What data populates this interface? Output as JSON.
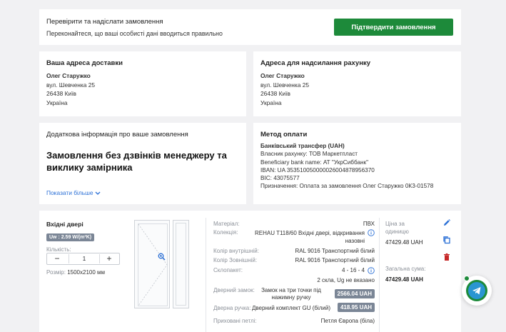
{
  "top": {
    "title": "Перевірити та надіслати замовлення",
    "subtitle": "Переконайтеся, що ваші особисті дані вводиться правильно",
    "confirm_label": "Підтвердити замовлення"
  },
  "shipping": {
    "title": "Ваша адреса доставки",
    "name": "Олег Старужко",
    "street": "вул. Шевченка 25",
    "city": "26438 Київ",
    "country": "Україна"
  },
  "billing": {
    "title": "Адреса для надсилання рахунку",
    "name": "Олег Старужко",
    "street": "вул. Шевченка 25",
    "city": "26438 Київ",
    "country": "Україна"
  },
  "extra": {
    "title": "Додаткова інформація про ваше замовлення",
    "text": "Замовлення без дзвінків менеджеру та виклику замірника",
    "show_more": "Показати більше"
  },
  "payment": {
    "title": "Метод оплати",
    "method": "Банківський трансфер (UAH)",
    "lines": [
      "Власник рахунку: ТОВ Маркетпласт",
      "Beneficiary bank name: АТ \"УкрСиббанк\"",
      "IBAN: UA 353510050000026004878956370",
      "BIC: 43075577",
      "Призначення: Оплата за замовлення Олег Старужко 0К3-01578"
    ]
  },
  "product": {
    "title": "Вхідні двері",
    "uw": "Uw : 2.59 W/(m²K)",
    "qty_label": "Кількість:",
    "qty_minus": "−",
    "qty_plus": "+",
    "qty": "1",
    "size_label": "Розмір:",
    "size": "1500x2100 мм",
    "specs": [
      {
        "k": "Матеріал:",
        "v": "ПВХ"
      },
      {
        "k": "Колекція:",
        "v": "REHAU T118/60 Вхідні двері, відкривання назовні"
      },
      {
        "k": "Колір внутрішній:",
        "v": "RAL 9016 Транспортний білий"
      },
      {
        "k": "Колір Зовнішній:",
        "v": "RAL 9016 Транспортний білий"
      },
      {
        "k": "Склопакет:",
        "v": "4 - 16 - 4"
      },
      {
        "k": "",
        "v": "2 скла, Ug не вказано"
      },
      {
        "k": "Дверний замок:",
        "v": "Замок на три точки під нажимну ручку",
        "price": "2566.04 UAH"
      },
      {
        "k": "Дверна ручка:",
        "v": "Дверний комплект GU (білий)",
        "price": "418.95 UAH"
      },
      {
        "k": "Приховані петлі:",
        "v": "Петля Європа (біла)"
      }
    ],
    "unit_price_label": "Ціна за одиницю",
    "unit_price": "47429.48 UAH",
    "total_label": "Загальна сума:",
    "total": "47429.48 UAH"
  },
  "icons": {
    "edit": "pencil-icon",
    "copy": "copy-icon",
    "delete": "trash-icon",
    "zoom": "zoom-icon",
    "chat": "telegram-icon",
    "info": "info-icon"
  },
  "colors": {
    "accent": "#1d8a3a",
    "link": "#2a6fd6",
    "badge": "#7b8696",
    "delete": "#c62828"
  }
}
